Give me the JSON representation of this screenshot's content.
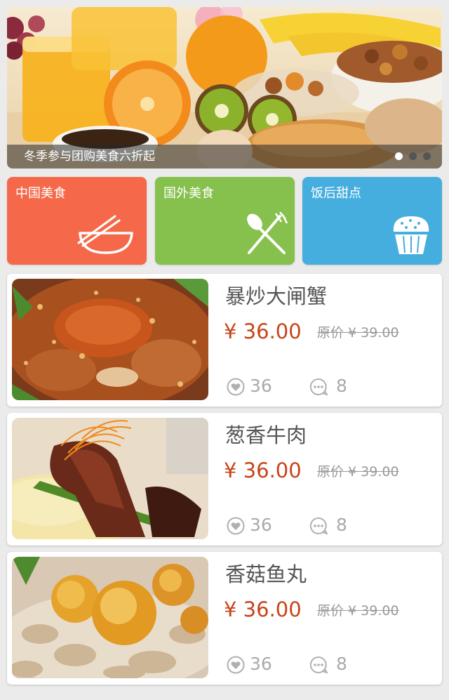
{
  "banner": {
    "caption": "冬季参与团购美食六折起",
    "slide_count": 3,
    "active_slide": 1
  },
  "categories": [
    {
      "label": "中国美食",
      "color": "#f5694a",
      "icon": "bowl-chopsticks-icon"
    },
    {
      "label": "国外美食",
      "color": "#86c04d",
      "icon": "fork-spoon-icon"
    },
    {
      "label": "饭后甜点",
      "color": "#45aede",
      "icon": "muffin-icon"
    }
  ],
  "products": [
    {
      "name": "暴炒大闸蟹",
      "price": "¥ 36.00",
      "original_price": "原价 ¥ 39.00",
      "likes": "36",
      "comments": "8"
    },
    {
      "name": "葱香牛肉",
      "price": "¥ 36.00",
      "original_price": "原价 ¥ 39.00",
      "likes": "36",
      "comments": "8"
    },
    {
      "name": "香菇鱼丸",
      "price": "¥ 36.00",
      "original_price": "原价 ¥ 39.00",
      "likes": "36",
      "comments": "8"
    }
  ],
  "colors": {
    "price": "#c8441a",
    "muted": "#999999",
    "background": "#ebebeb"
  }
}
